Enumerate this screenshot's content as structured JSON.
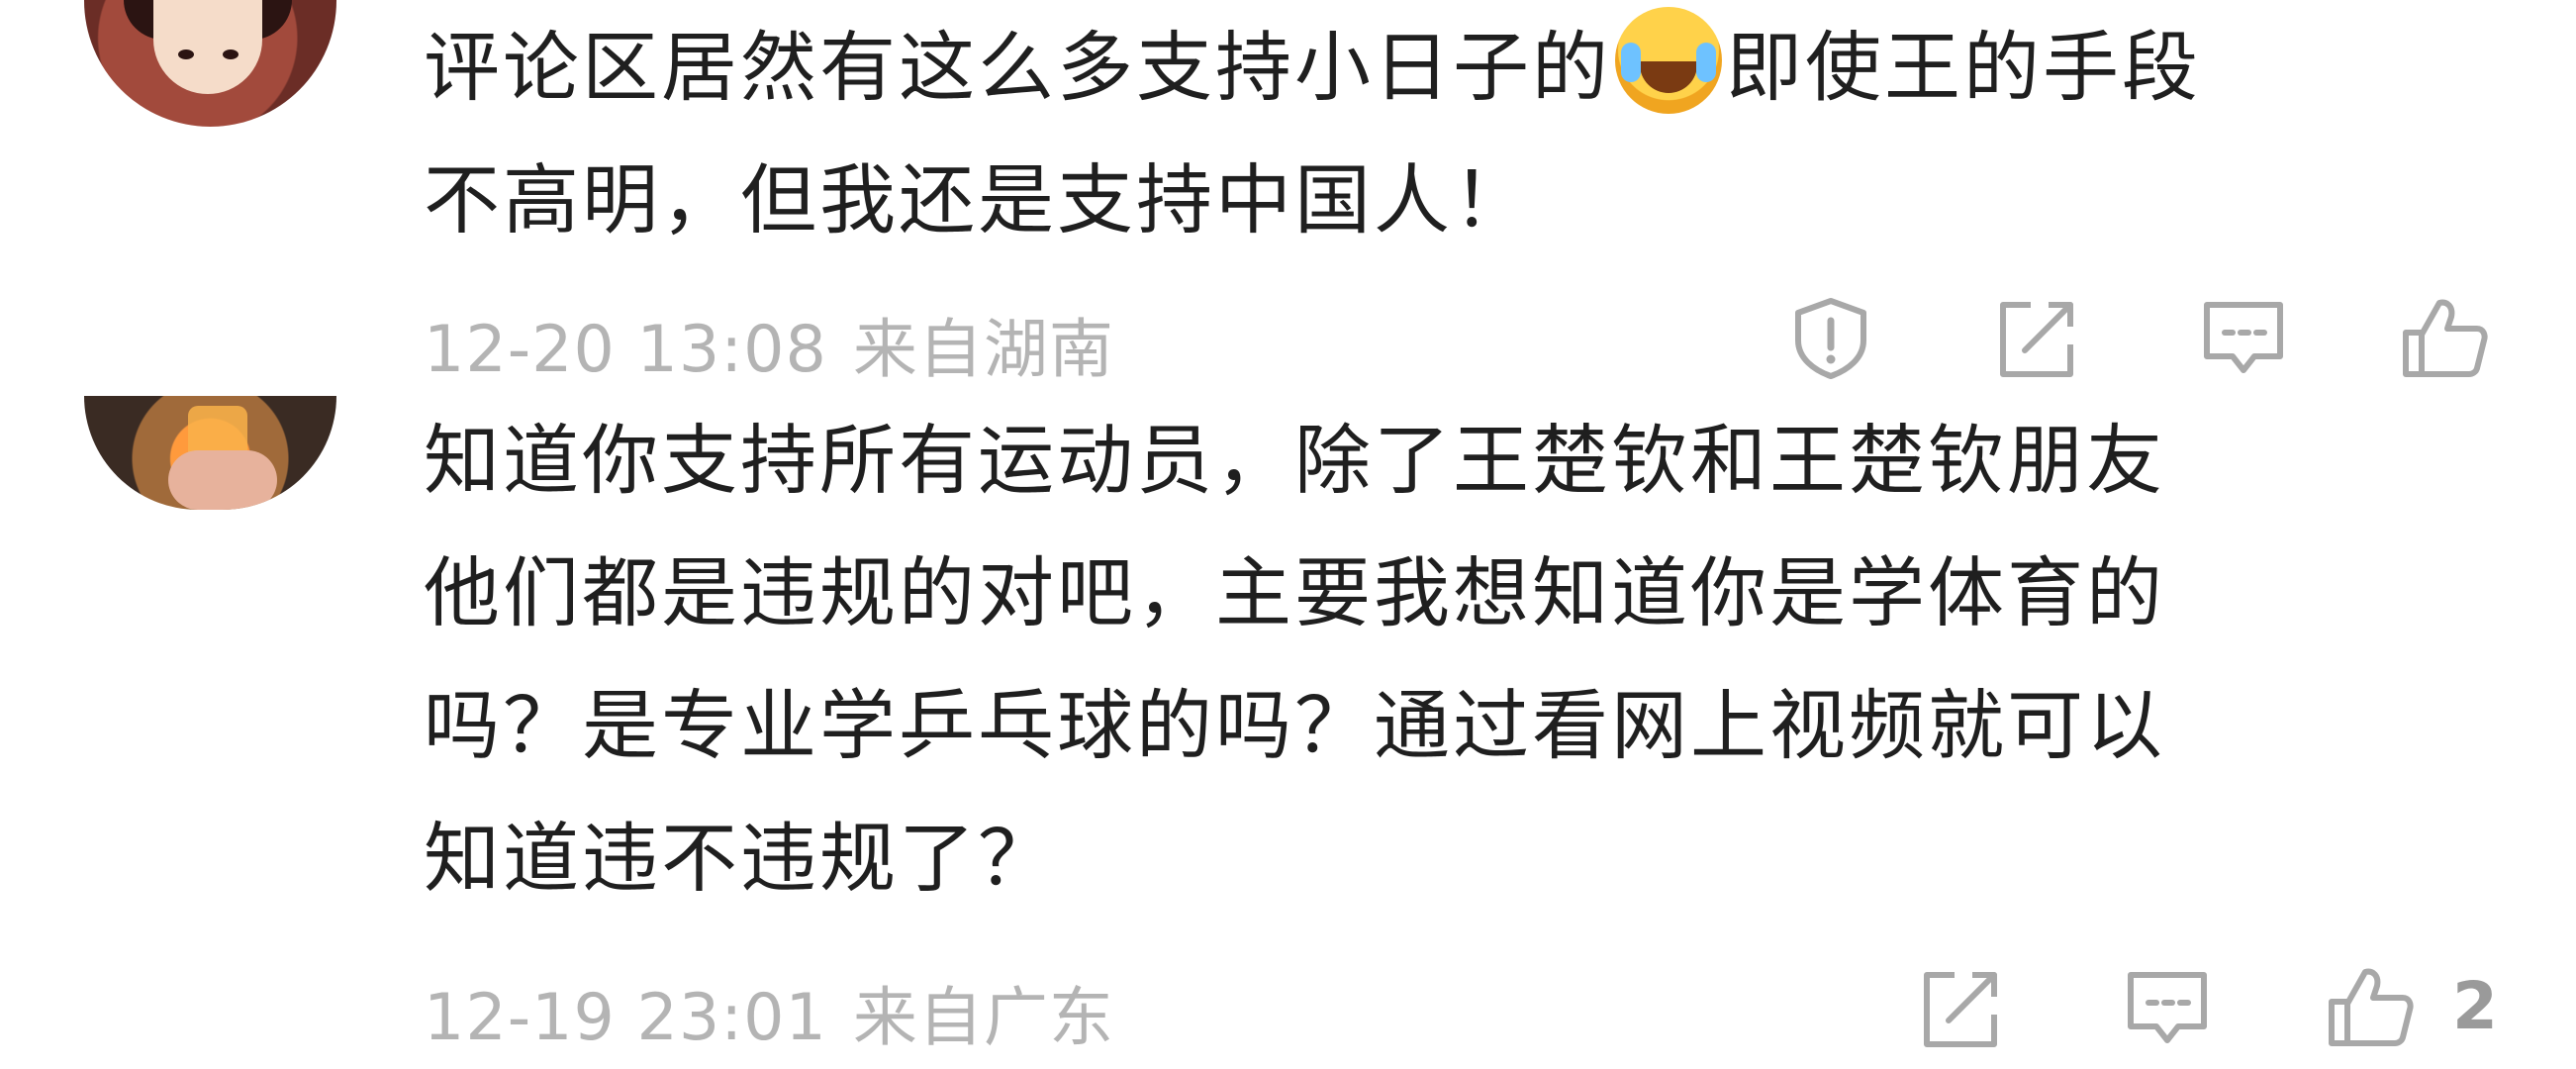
{
  "comments": [
    {
      "text_lines": [
        "评论区居然有这么多支持小日子的",
        "即使王的手段",
        "不高明，但我还是支持中国人！"
      ],
      "emoji": "rolling-laughing-emoji",
      "time": "12-20 13:08",
      "location": "来自湖南",
      "actions": [
        "report-icon",
        "share-icon",
        "reply-icon",
        "like-icon"
      ],
      "like_count": ""
    },
    {
      "text_lines": [
        "知道你支持所有运动员，除了王楚钦和王楚钦朋友",
        "他们都是违规的对吧，主要我想知道你是学体育的",
        "吗？是专业学乒乓球的吗？通过看网上视频就可以",
        "知道违不违规了？"
      ],
      "time": "12-19 23:01",
      "location": "来自广东",
      "actions": [
        "share-icon",
        "reply-icon",
        "like-icon"
      ],
      "like_count": "2"
    }
  ],
  "colors": {
    "text": "#1f1f1f",
    "meta": "#b4b4b4",
    "icon": "#a8a8a8"
  }
}
